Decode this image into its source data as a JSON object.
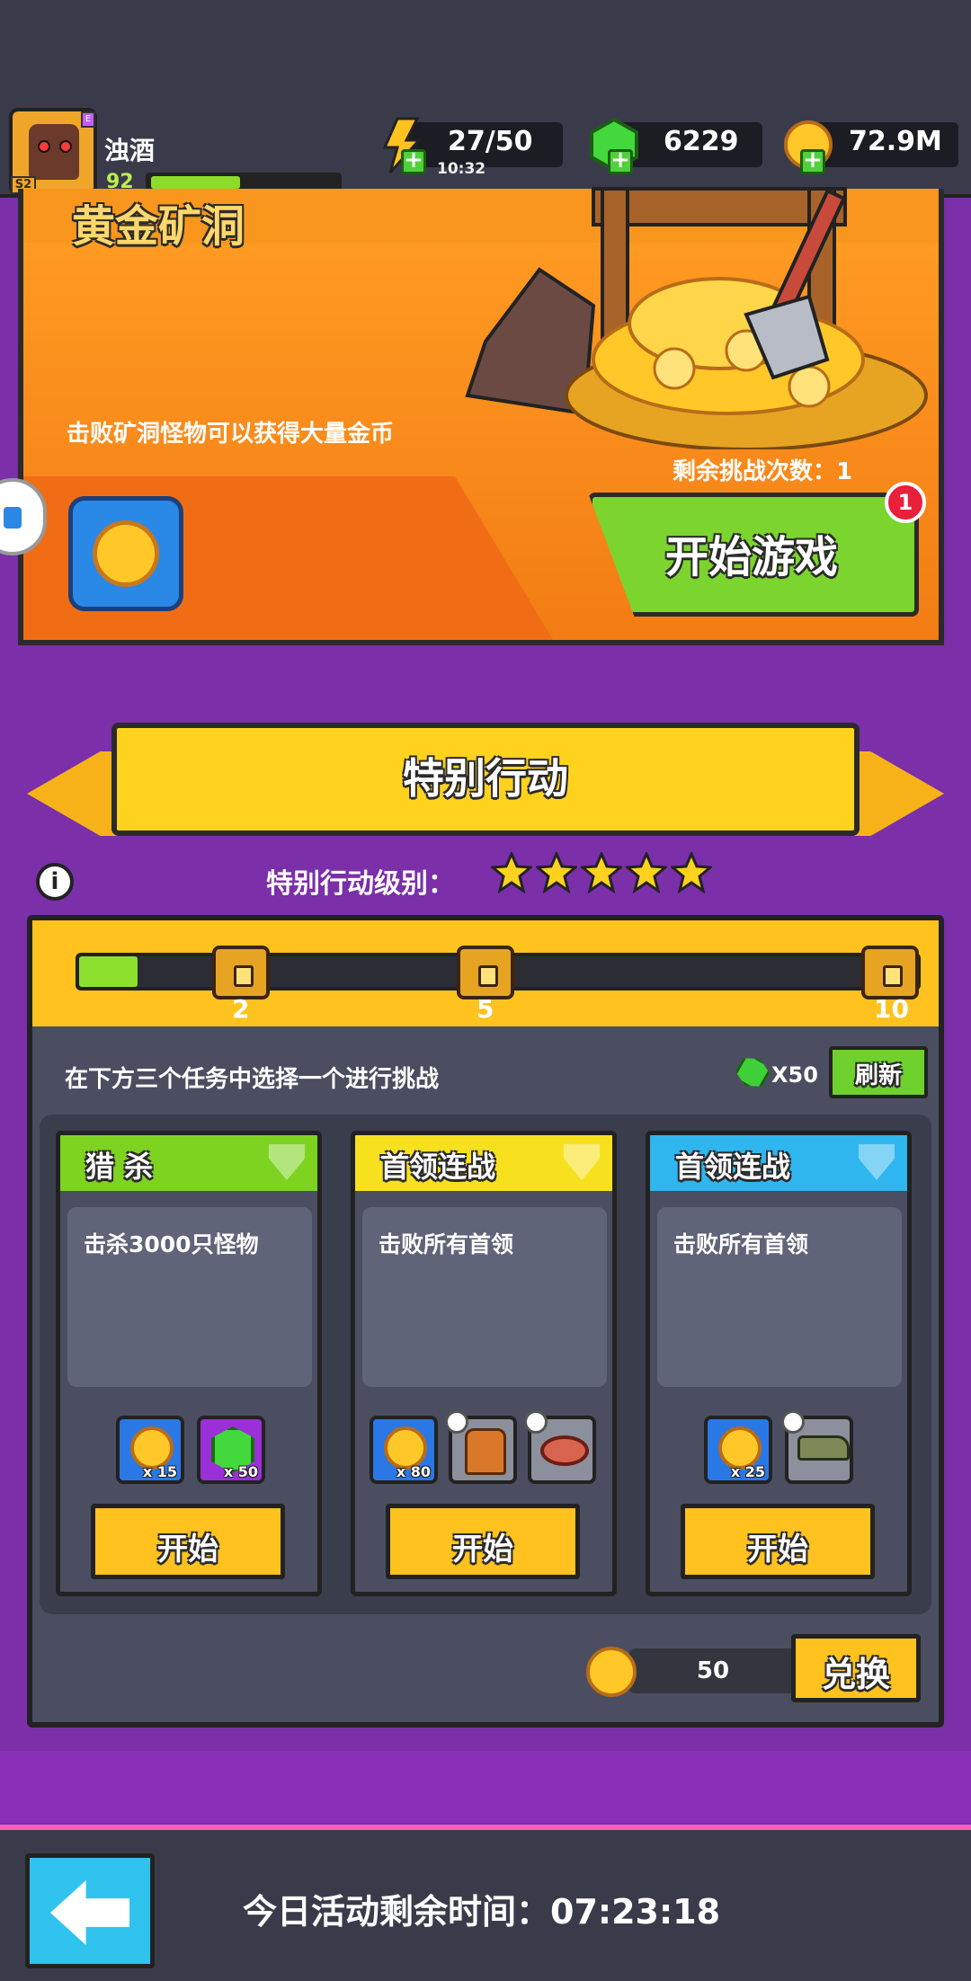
{
  "player": {
    "name": "浊酒",
    "level": "92",
    "season": "S2",
    "badge": "E",
    "xp_fraction": 0.48
  },
  "resources": {
    "energy": "27/50",
    "energy_timer": "10:32",
    "gems": "6229",
    "gold": "72.9M"
  },
  "mine": {
    "title": "黄金矿洞",
    "description": "击败矿洞怪物可以获得大量金币",
    "challenges_left": "剩余挑战次数：1",
    "start_label": "开始游戏",
    "notification_count": "1"
  },
  "special": {
    "title": "特别行动",
    "rank_label": "特别行动级别：",
    "stars": 5,
    "progress_fraction": 0.07,
    "milestones": [
      "2",
      "5",
      "10"
    ],
    "choose_text": "在下方三个任务中选择一个进行挑战",
    "refresh_cost": "X50",
    "refresh_label": "刷新"
  },
  "tasks": [
    {
      "title": "猎 杀",
      "description": "击杀3000只怪物",
      "header_color": "#7ed321",
      "rewards": [
        {
          "icon": "gold-token-icon",
          "qty": "x 15"
        },
        {
          "icon": "gem-icon",
          "qty": "x 50"
        }
      ],
      "start_label": "开始"
    },
    {
      "title": "首领连战",
      "description": "击败所有首领",
      "header_color": "#f7e11e",
      "rewards": [
        {
          "icon": "gold-token-icon",
          "qty": "x 80"
        },
        {
          "icon": "vest-armor-icon",
          "qty": ""
        },
        {
          "icon": "ring-icon",
          "qty": ""
        }
      ],
      "start_label": "开始"
    },
    {
      "title": "首领连战",
      "description": "击败所有首领",
      "header_color": "#2fb6ee",
      "rewards": [
        {
          "icon": "gold-token-icon",
          "qty": "x 25"
        },
        {
          "icon": "revolver-icon",
          "qty": ""
        }
      ],
      "start_label": "开始"
    }
  ],
  "exchange": {
    "amount": "50",
    "label": "兑换"
  },
  "footer": {
    "time_remaining": "今日活动剩余时间：07:23:18"
  }
}
